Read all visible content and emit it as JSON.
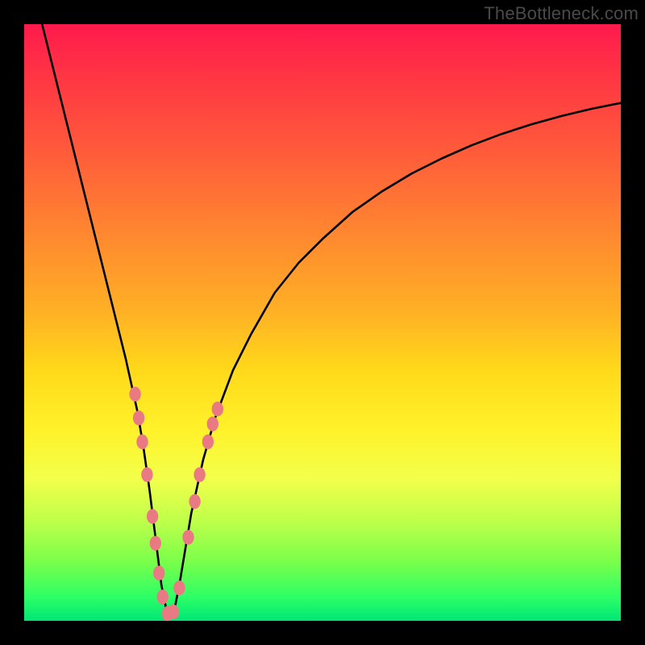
{
  "watermark": "TheBottleneck.com",
  "colors": {
    "curve_stroke": "#000000",
    "bead_fill": "#e97a84",
    "bead_stroke": "#e97a84"
  },
  "chart_data": {
    "type": "line",
    "title": "",
    "xlabel": "",
    "ylabel": "",
    "xlim": [
      0,
      100
    ],
    "ylim": [
      0,
      100
    ],
    "notch_x": 24,
    "series": [
      {
        "name": "bottleneck-curve",
        "x": [
          3,
          5,
          7,
          9,
          11,
          13,
          15,
          17,
          19,
          20,
          21,
          22,
          23,
          24,
          25,
          26,
          27,
          28,
          30,
          32,
          35,
          38,
          42,
          46,
          50,
          55,
          60,
          65,
          70,
          75,
          80,
          85,
          90,
          95,
          100
        ],
        "y": [
          100,
          92,
          84,
          76,
          68,
          60,
          52,
          44,
          35,
          29,
          22,
          14,
          6,
          1,
          1,
          6,
          12,
          18,
          27,
          34,
          42,
          48,
          55,
          60,
          64,
          68.5,
          72,
          75,
          77.5,
          79.7,
          81.6,
          83.2,
          84.6,
          85.8,
          86.8
        ]
      }
    ],
    "beads": [
      {
        "x": 18.6,
        "y": 38.0
      },
      {
        "x": 19.2,
        "y": 34.0
      },
      {
        "x": 19.8,
        "y": 30.0
      },
      {
        "x": 20.6,
        "y": 24.5
      },
      {
        "x": 21.5,
        "y": 17.5
      },
      {
        "x": 22.0,
        "y": 13.0
      },
      {
        "x": 22.6,
        "y": 8.0
      },
      {
        "x": 23.2,
        "y": 4.0
      },
      {
        "x": 24.0,
        "y": 1.2
      },
      {
        "x": 25.0,
        "y": 1.5
      },
      {
        "x": 26.0,
        "y": 5.5
      },
      {
        "x": 27.5,
        "y": 14.0
      },
      {
        "x": 28.6,
        "y": 20.0
      },
      {
        "x": 29.4,
        "y": 24.5
      },
      {
        "x": 30.8,
        "y": 30.0
      },
      {
        "x": 31.6,
        "y": 33.0
      },
      {
        "x": 32.4,
        "y": 35.5
      }
    ]
  }
}
